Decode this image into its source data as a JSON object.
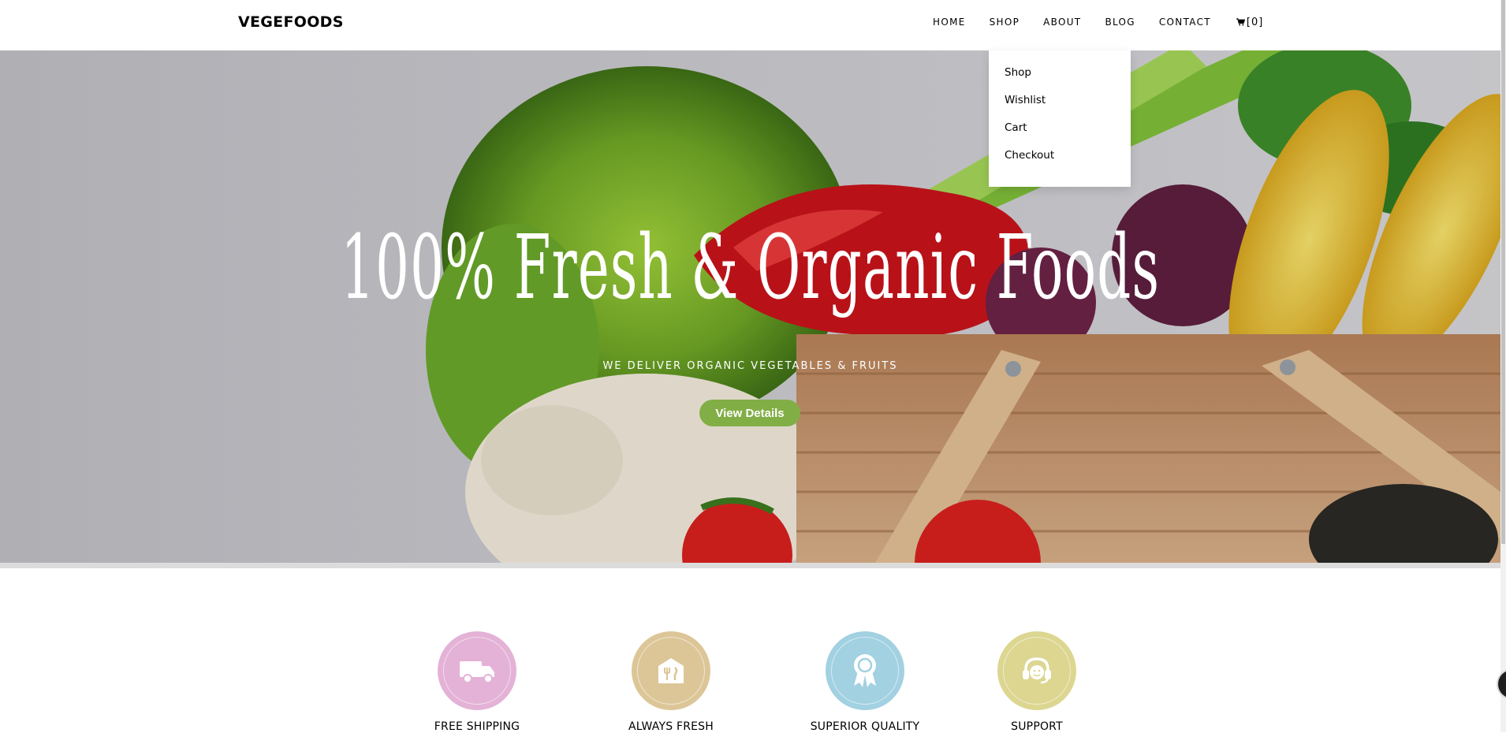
{
  "brand": "VEGEFOODS",
  "nav": {
    "items": [
      "HOME",
      "SHOP",
      "ABOUT",
      "BLOG",
      "CONTACT"
    ],
    "cart_label": "[0]",
    "cart_icon": "cart-icon"
  },
  "dropdown": {
    "items": [
      "Shop",
      "Wishlist",
      "Cart",
      "Checkout"
    ]
  },
  "hero": {
    "title": "100% Fresh & Organic Foods",
    "subtitle": "WE DELIVER ORGANIC VEGETABLES & FRUITS",
    "button_label": "View Details",
    "button_color": "#82ae46"
  },
  "services": [
    {
      "title": "FREE SHIPPING",
      "icon": "truck-icon",
      "color": "#e4b2d6"
    },
    {
      "title": "ALWAYS FRESH",
      "icon": "fresh-food-icon",
      "color": "#dcc698"
    },
    {
      "title": "SUPERIOR QUALITY",
      "icon": "award-icon",
      "color": "#a2d1e1"
    },
    {
      "title": "SUPPORT",
      "icon": "headset-support-icon",
      "color": "#dcd691"
    }
  ]
}
